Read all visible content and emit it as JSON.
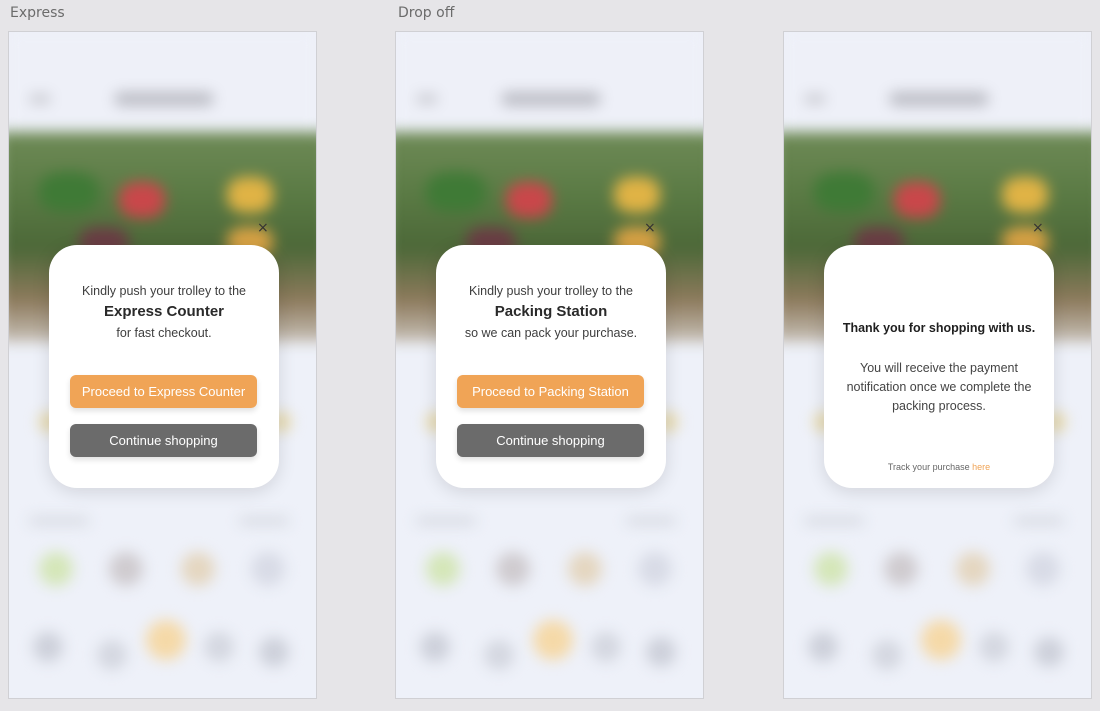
{
  "frames": [
    {
      "label": "Express",
      "modal": {
        "line1": "Kindly push your trolley to the",
        "highlight": "Express Counter",
        "line3": "for fast checkout.",
        "primary_button": "Proceed to Express Counter",
        "secondary_button": "Continue shopping",
        "close": "×"
      }
    },
    {
      "label": "Drop off",
      "modal": {
        "line1": "Kindly push your trolley to the",
        "highlight": "Packing Station",
        "line3": "so we can pack your purchase.",
        "primary_button": "Proceed to Packing Station",
        "secondary_button": "Continue shopping",
        "close": "×"
      }
    },
    {
      "label": "",
      "modal": {
        "title": "Thank you for shopping with us.",
        "body": "You will receive the payment notification once we complete the packing process.",
        "track_text": "Track your purchase ",
        "track_link": "here",
        "close": "×"
      }
    }
  ],
  "colors": {
    "accent": "#f0a456",
    "secondary_button": "#6b6b6b",
    "canvas": "#e6e5e8",
    "frame_bg": "#eef1f9"
  }
}
